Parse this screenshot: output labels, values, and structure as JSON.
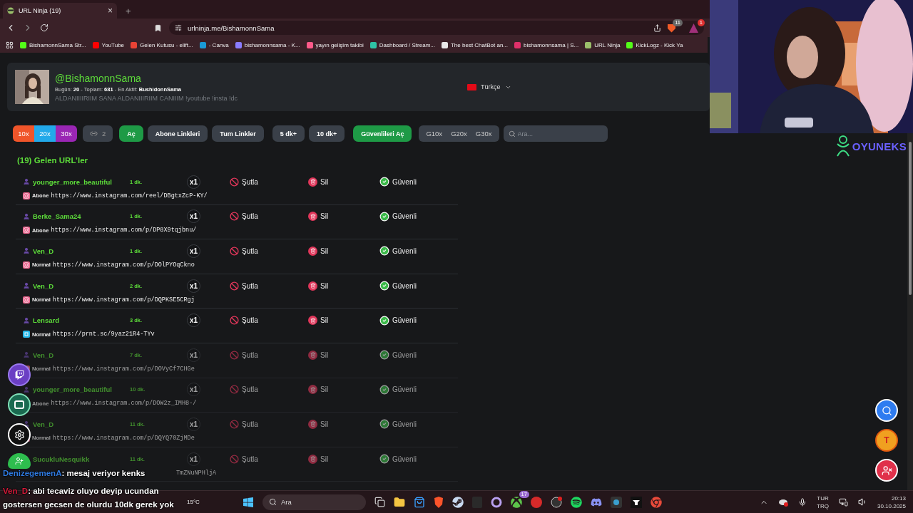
{
  "browser": {
    "tab": {
      "title": "URL Ninja (19)",
      "close": "×"
    },
    "new_tab": "+",
    "url": "urlninja.me/BishamonnSama",
    "shield_badge": "11",
    "alert_badge": "1",
    "bookmarks": [
      {
        "label": "BishamonnSama Str...",
        "color": "#53fc18"
      },
      {
        "label": "YouTube",
        "color": "#ff0000"
      },
      {
        "label": "Gelen Kutusu - elift...",
        "color": "#ea4335"
      },
      {
        "label": "- Canva",
        "color": "#1a9ad6"
      },
      {
        "label": "bishamonnsama - K...",
        "color": "#8a7cff"
      },
      {
        "label": "yayın gelişim takibi",
        "color": "#ff5a8a"
      },
      {
        "label": "Dashboard / Stream...",
        "color": "#2ec4a5"
      },
      {
        "label": "The best ChatBot an...",
        "color": "#e8e8e8"
      },
      {
        "label": "bishamonnsama | S...",
        "color": "#e0306a"
      },
      {
        "label": "URL Ninja",
        "color": "#9bbf6a"
      },
      {
        "label": "KickLogz - Kick Ya",
        "color": "#53fc18"
      }
    ]
  },
  "profile": {
    "handle": "@BishamonnSama",
    "stats": "Bugün: **20** - Toplam: **681** - En Aktif: **BushidonnSama**",
    "message": "ALDANIIIIRIIM SANA ALDANIIIRIIM CANIIIM !youtube !insta !dc",
    "language": "Türkçe"
  },
  "toolbar": {
    "multipliers": [
      {
        "label": "10x",
        "color": "#f0552a"
      },
      {
        "label": "20x",
        "color": "#22a9ea"
      },
      {
        "label": "30x",
        "color": "#9a26b4"
      }
    ],
    "link_count": "2",
    "buttons": [
      {
        "label": "Aç",
        "kind": "green"
      },
      {
        "label": "Abone Linkleri",
        "kind": "grey"
      },
      {
        "label": "Tum Linkler",
        "kind": "grey"
      },
      {
        "label": "5 dk+",
        "kind": "grey"
      },
      {
        "label": "10 dk+",
        "kind": "grey"
      },
      {
        "label": "Güvenlileri Aç",
        "kind": "green"
      }
    ],
    "g_filters": [
      "G10x",
      "G20x",
      "G30x"
    ],
    "search": {
      "placeholder": "Ara..."
    }
  },
  "heading": "(19) Gelen URL’ler",
  "rows": [
    {
      "user": "younger_more_beautiful",
      "time": "1 dk.",
      "count": "x1",
      "actions": [
        "Şutla",
        "Sil",
        "Güvenli"
      ],
      "kind": "instagram",
      "type": "Abone",
      "url": "https://www.instagram.com/reel/DBgtxZcP-KY/",
      "faded": false
    },
    {
      "user": "Berke_Sama24",
      "time": "1 dk.",
      "count": "x1",
      "actions": [
        "Şutla",
        "Sil",
        "Güvenli"
      ],
      "kind": "instagram",
      "type": "Abone",
      "url": "https://www.instagram.com/p/DP8X9tqjbnu/",
      "faded": false
    },
    {
      "user": "Ven_D",
      "time": "1 dk.",
      "count": "x1",
      "actions": [
        "Şutla",
        "Sil",
        "Güvenli"
      ],
      "kind": "instagram",
      "type": "Normal",
      "url": "https://www.instagram.com/p/DOlPYOqCkno",
      "faded": false
    },
    {
      "user": "Ven_D",
      "time": "2 dk.",
      "count": "x1",
      "actions": [
        "Şutla",
        "Sil",
        "Güvenli"
      ],
      "kind": "instagram",
      "type": "Normal",
      "url": "https://www.instagram.com/p/DQPKSE5CRgj",
      "faded": false
    },
    {
      "user": "Lensard",
      "time": "3 dk.",
      "count": "x1",
      "actions": [
        "Şutla",
        "Sil",
        "Güvenli"
      ],
      "kind": "screenshot",
      "type": "Normal",
      "url": "https://prnt.sc/9yaz21R4-TYv",
      "faded": false
    },
    {
      "user": "Ven_D",
      "time": "7 dk.",
      "count": "x1",
      "actions": [
        "Şutla",
        "Sil",
        "Güvenli"
      ],
      "kind": "instagram",
      "type": "Normal",
      "url": "https://www.instagram.com/p/DOVyCf7CHGe",
      "faded": true
    },
    {
      "user": "younger_more_beautiful",
      "time": "10 dk.",
      "count": "x1",
      "actions": [
        "Şutla",
        "Sil",
        "Güvenli"
      ],
      "kind": "instagram",
      "type": "Abone",
      "url": "https://www.instagram.com/p/DOW2z_IMH8-/",
      "faded": true
    },
    {
      "user": "Ven_D",
      "time": "11 dk.",
      "count": "x1",
      "actions": [
        "Şutla",
        "Sil",
        "Güvenli"
      ],
      "kind": "instagram",
      "type": "Normal",
      "url": "https://www.instagram.com/p/DQYQ70ZjMDe",
      "faded": true
    },
    {
      "user": "SucukluNesquikk",
      "time": "11 dk.",
      "count": "x1",
      "actions": [
        "Şutla",
        "Sil",
        "Güvenli"
      ],
      "url_tail": "TmZNuNPHljA",
      "faded": true
    }
  ],
  "fab_letter": "T",
  "logo": "OYUNEKS",
  "chat": [
    {
      "user": "DenizegemenA",
      "color": "#2f7ae0",
      "text": ": mesaj veriyor kenks"
    },
    {
      "user": "Ven_D",
      "color": "#d81a3a",
      "text": ": abi tecaviz oluyo deyip ucundan gostersen gecsen de olurdu 10dk gerek yok"
    }
  ],
  "taskbar": {
    "weather": "15°C",
    "search": {
      "placeholder": "Ara"
    },
    "app_badge": "17",
    "language": [
      "TUR",
      "TRQ"
    ],
    "time": "20:13",
    "date": "30.10.2025"
  }
}
